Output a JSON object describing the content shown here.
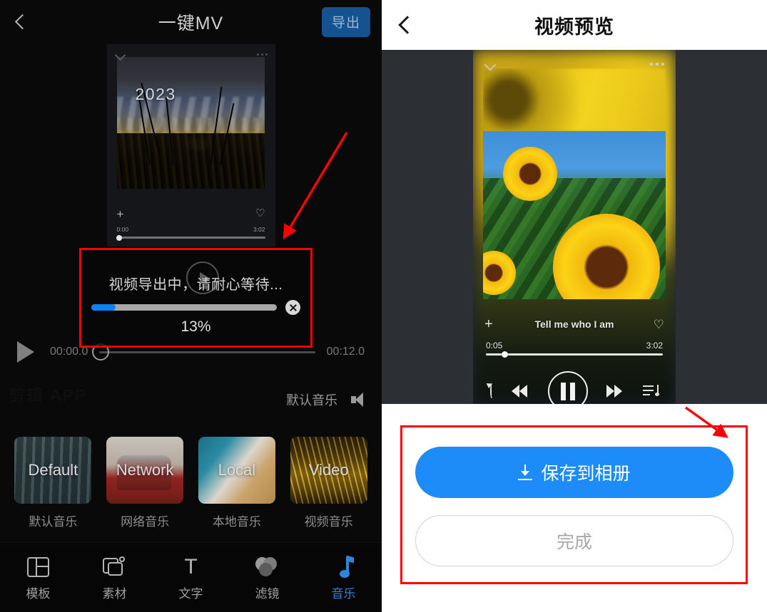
{
  "editor": {
    "back_icon": "chevron-left-icon",
    "title": "一键MV",
    "export_label": "导出",
    "preview_card": {
      "year_text": "2023",
      "collapse_icon": "chevron-down-icon",
      "more_icon": "more-horizontal-icon",
      "add_icon": "plus-icon",
      "favorite_icon": "heart-icon",
      "current_time": "0:00",
      "total_time": "3:02"
    },
    "progress_dialog": {
      "message": "视频导出中，请耐心等待...",
      "percent_label": "13%",
      "percent_value": 13,
      "close_icon": "close-circle-icon",
      "fill_color": "#0d82f5",
      "track_color": "#a8a8a8",
      "highlight_color": "#ff0000"
    },
    "timeline": {
      "play_icon": "play-icon",
      "start_time": "00:00.0",
      "end_time": "00:12.0",
      "playhead_icon": "scrubber-handle"
    },
    "watermark": "剪辑 APP",
    "music_bar": {
      "label": "默认音乐",
      "speaker_icon": "speaker-icon"
    },
    "music_cards": [
      {
        "thumb_text": "Default",
        "label": "默认音乐",
        "theme": "th-default"
      },
      {
        "thumb_text": "Network",
        "label": "网络音乐",
        "theme": "th-network"
      },
      {
        "thumb_text": "Local",
        "label": "本地音乐",
        "theme": "th-local"
      },
      {
        "thumb_text": "Video",
        "label": "视频音乐",
        "theme": "th-video"
      }
    ],
    "tabs": [
      {
        "label": "模板",
        "icon": "template-icon",
        "active": false
      },
      {
        "label": "素材",
        "icon": "media-icon",
        "active": false
      },
      {
        "label": "文字",
        "icon": "text-icon",
        "glyph": "T",
        "active": false
      },
      {
        "label": "滤镜",
        "icon": "filter-icon",
        "active": false
      },
      {
        "label": "音乐",
        "icon": "music-note-icon",
        "active": true
      }
    ],
    "accent_color": "#2f86d8"
  },
  "preview": {
    "back_icon": "chevron-left-icon",
    "title": "视频预览",
    "video": {
      "collapse_icon": "chevron-down-icon",
      "more_icon": "more-horizontal-icon",
      "add_icon": "plus-icon",
      "favorite_icon": "heart-icon",
      "song_title": "Tell me who I am",
      "current_time": "0:05",
      "total_time": "3:02",
      "controls": [
        {
          "icon": "repeat-icon"
        },
        {
          "icon": "rewind-icon"
        },
        {
          "icon": "pause-icon"
        },
        {
          "icon": "fast-forward-icon"
        },
        {
          "icon": "playlist-icon"
        }
      ]
    },
    "actions": {
      "save_label": "保存到相册",
      "save_icon": "download-icon",
      "save_color": "#1d8cf8",
      "done_label": "完成",
      "highlight_color": "#ff0000"
    }
  },
  "annotations": {
    "arrow_color": "#ff0000",
    "arrow_left_name": "arrow-to-progress-dialog",
    "arrow_right_name": "arrow-to-save-buttons"
  }
}
